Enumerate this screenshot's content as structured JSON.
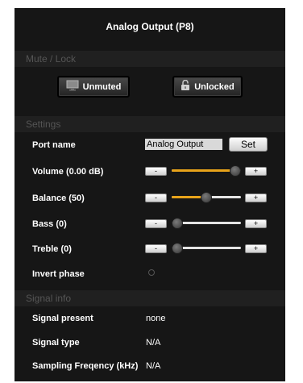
{
  "title": "Analog Output (P8)",
  "sections": {
    "mute_lock": "Mute / Lock",
    "settings": "Settings",
    "signal_info": "Signal info"
  },
  "buttons": {
    "mute": {
      "label": "Unmuted",
      "icon": "speaker-icon"
    },
    "lock": {
      "label": "Unlocked",
      "icon": "unlocked-padlock-icon"
    }
  },
  "port": {
    "label": "Port name",
    "value": "Analog Output",
    "set_label": "Set"
  },
  "controls": [
    {
      "label": "Volume (0.00 dB)",
      "minus": "-",
      "plus": "+",
      "fraction": 1.0
    },
    {
      "label": "Balance (50)",
      "minus": "-",
      "plus": "+",
      "fraction": 0.5
    },
    {
      "label": "Bass (0)",
      "minus": "-",
      "plus": "+",
      "fraction": 0.0
    },
    {
      "label": "Treble (0)",
      "minus": "-",
      "plus": "+",
      "fraction": 0.0
    }
  ],
  "invert_phase": {
    "label": "Invert phase",
    "checked": false
  },
  "signal_info": [
    {
      "label": "Signal present",
      "value": "none"
    },
    {
      "label": "Signal type",
      "value": "N/A"
    },
    {
      "label": "Sampling Freqency (kHz)",
      "value": "N/A"
    }
  ],
  "colors": {
    "panel": "#161616",
    "accent": "#e8a31a",
    "section_bg": "#202020",
    "section_text": "#555555"
  }
}
